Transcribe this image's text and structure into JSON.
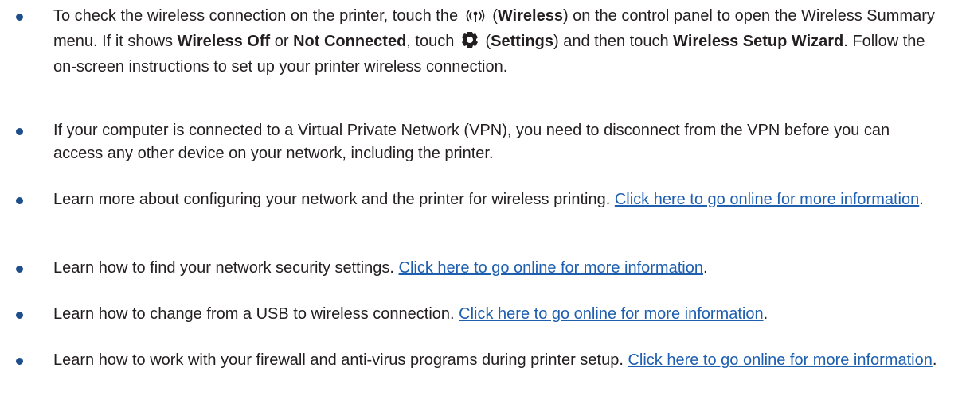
{
  "items": [
    {
      "p1": "To check the wireless connection on the printer, touch the ",
      "icon_wireless": "wireless-icon",
      "p2": " (",
      "b1": "Wireless",
      "p3": ") on the control panel to open the Wireless Summary menu. If it shows ",
      "b2": "Wireless Off",
      "p4": " or ",
      "b3": "Not Connected",
      "p5": ", touch ",
      "icon_settings": "settings-icon",
      "p6": " (",
      "b4": "Settings",
      "p7": ") and then touch ",
      "b5": "Wireless Setup Wizard",
      "p8": ". Follow the on-screen instructions to set up your printer wireless connection."
    },
    {
      "text": "If your computer is connected to a Virtual Private Network (VPN), you need to disconnect from the VPN before you can access any other device on your network, including the printer."
    },
    {
      "text": "Learn more about configuring your network and the printer for wireless printing. ",
      "link": "Click here to go online for more information",
      "suffix": "."
    },
    {
      "text": "Learn how to find your network security settings. ",
      "link": "Click here to go online for more information",
      "suffix": "."
    },
    {
      "text": "Learn how to change from a USB to wireless connection. ",
      "link": "Click here to go online for more information",
      "suffix": "."
    },
    {
      "text": "Learn how to work with your firewall and anti-virus programs during printer setup. ",
      "link": "Click here to go online for more information",
      "suffix": "."
    }
  ],
  "colors": {
    "bullet": "#1f4e8c",
    "link": "#1f5fb0",
    "text": "#231f20"
  }
}
